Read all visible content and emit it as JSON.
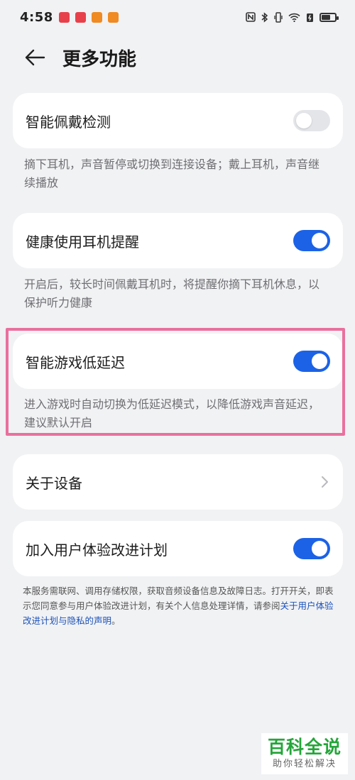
{
  "status_bar": {
    "time": "4:58",
    "app_icon_colors": [
      "#e8404a",
      "#e8404a",
      "#f08a22",
      "#f08a22"
    ],
    "right_icons": [
      "nfc-icon",
      "bluetooth-icon",
      "vibrate-icon",
      "wifi-icon",
      "battery-saver-icon",
      "battery-icon"
    ]
  },
  "header": {
    "title": "更多功能"
  },
  "settings": [
    {
      "id": "wear-detect",
      "label": "智能佩戴检测",
      "toggle": "off",
      "description": "摘下耳机，声音暂停或切换到连接设备；戴上耳机，声音继续播放"
    },
    {
      "id": "health-remind",
      "label": "健康使用耳机提醒",
      "toggle": "on",
      "description": "开启后，较长时间佩戴耳机时，将提醒你摘下耳机休息，以保护听力健康"
    },
    {
      "id": "game-low-latency",
      "label": "智能游戏低延迟",
      "toggle": "on",
      "description": "进入游戏时自动切换为低延迟模式，以降低游戏声音延迟，建议默认开启"
    }
  ],
  "about_device": {
    "label": "关于设备"
  },
  "ux_plan": {
    "label": "加入用户体验改进计划",
    "toggle": "on"
  },
  "footer": {
    "text": "本服务需联网、调用存储权限，获取音频设备信息及故障日志。打开开关，即表示您同意参与用户体验改进计划，有关个人信息处理详情，请参阅",
    "link": "关于用户体验改进计划与隐私的声明",
    "period": "。"
  },
  "watermark": {
    "brand": "百科全说",
    "tagline": "助你轻松解决"
  },
  "colors": {
    "accent": "#1c62e6",
    "highlight_border": "#e9709d",
    "watermark_green": "#25a53a"
  }
}
